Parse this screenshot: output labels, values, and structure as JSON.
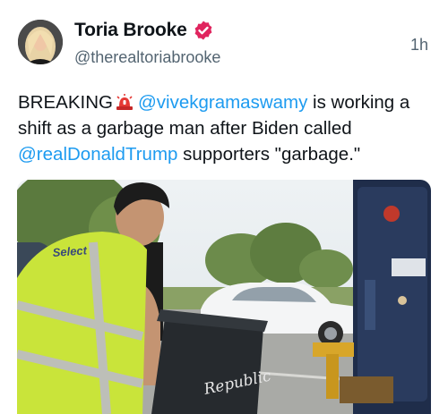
{
  "tweet": {
    "author_name": "Toria Brooke",
    "author_handle": "@therealtoriabrooke",
    "time": "1h",
    "text_parts": {
      "breaking": "BREAKING",
      "mention1": "@vivekgramaswamy",
      "after_mention1": " is working a shift as a garbage man after Biden called ",
      "mention2": "@realDonaldTrump",
      "after_mention2": " supporters \"garbage.\""
    },
    "siren_emoji": "siren-icon"
  },
  "media": {
    "vest_text": "Select",
    "bin_text": "Republic"
  },
  "colors": {
    "mention": "#1d9bf0",
    "verified": "#e0245e",
    "handle": "#536471"
  }
}
